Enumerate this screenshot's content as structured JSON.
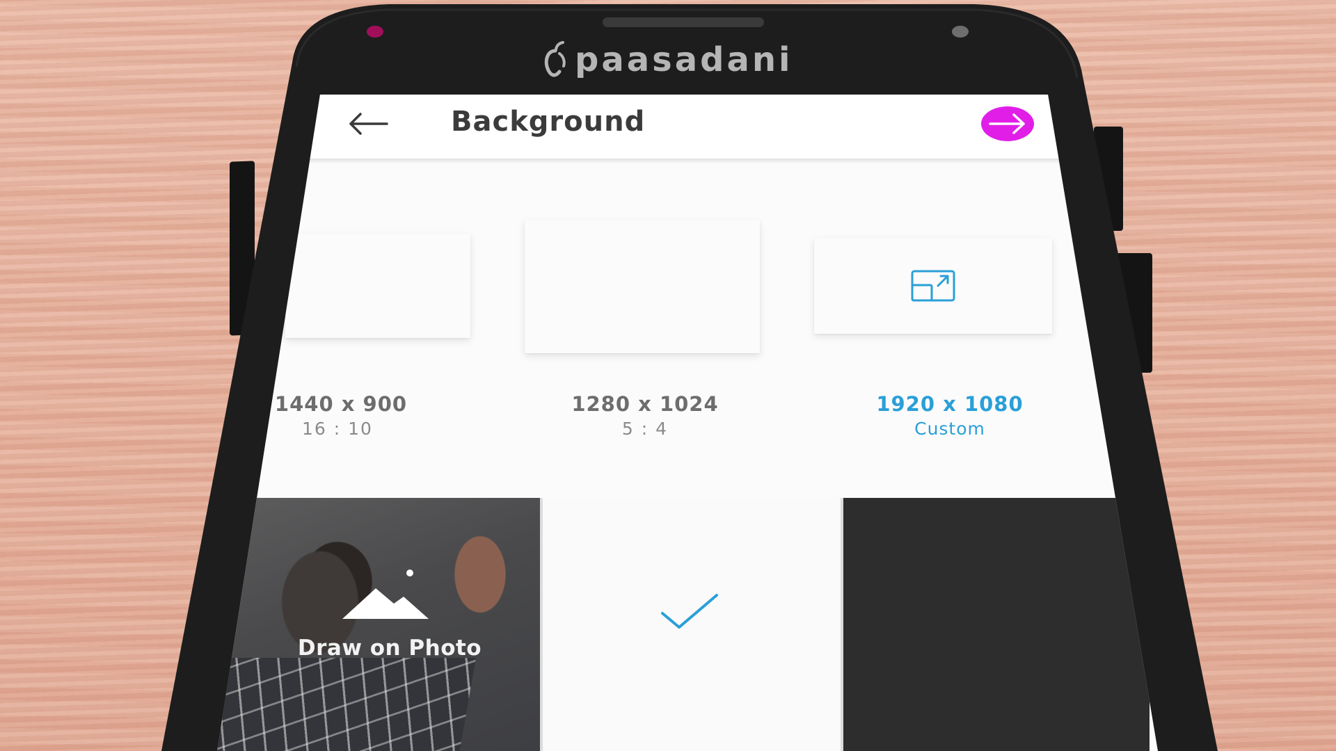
{
  "phone": {
    "brand_name": "paasadani",
    "brand_logo_icon": "apple-leaf-icon",
    "accent_color": "#e11ee8",
    "selected_color": "#2a9fd8"
  },
  "appbar": {
    "title": "Background",
    "back_icon": "arrow-left-icon",
    "next_icon": "arrow-right-icon"
  },
  "resolutions": [
    {
      "size": "1440 x 900",
      "ratio": "16 : 10"
    },
    {
      "size": "1280 x 1024",
      "ratio": "5 : 4"
    },
    {
      "size": "1920 x 1080",
      "ratio": "Custom",
      "selected": true,
      "icon": "custom-resize-icon"
    }
  ],
  "backgrounds": [
    {
      "label": "Draw on Photo",
      "icon": "image-mountain-icon"
    },
    {
      "color": "#fafafa",
      "selected": true,
      "icon": "checkmark-icon"
    },
    {
      "color": "#2d2d2d"
    }
  ]
}
